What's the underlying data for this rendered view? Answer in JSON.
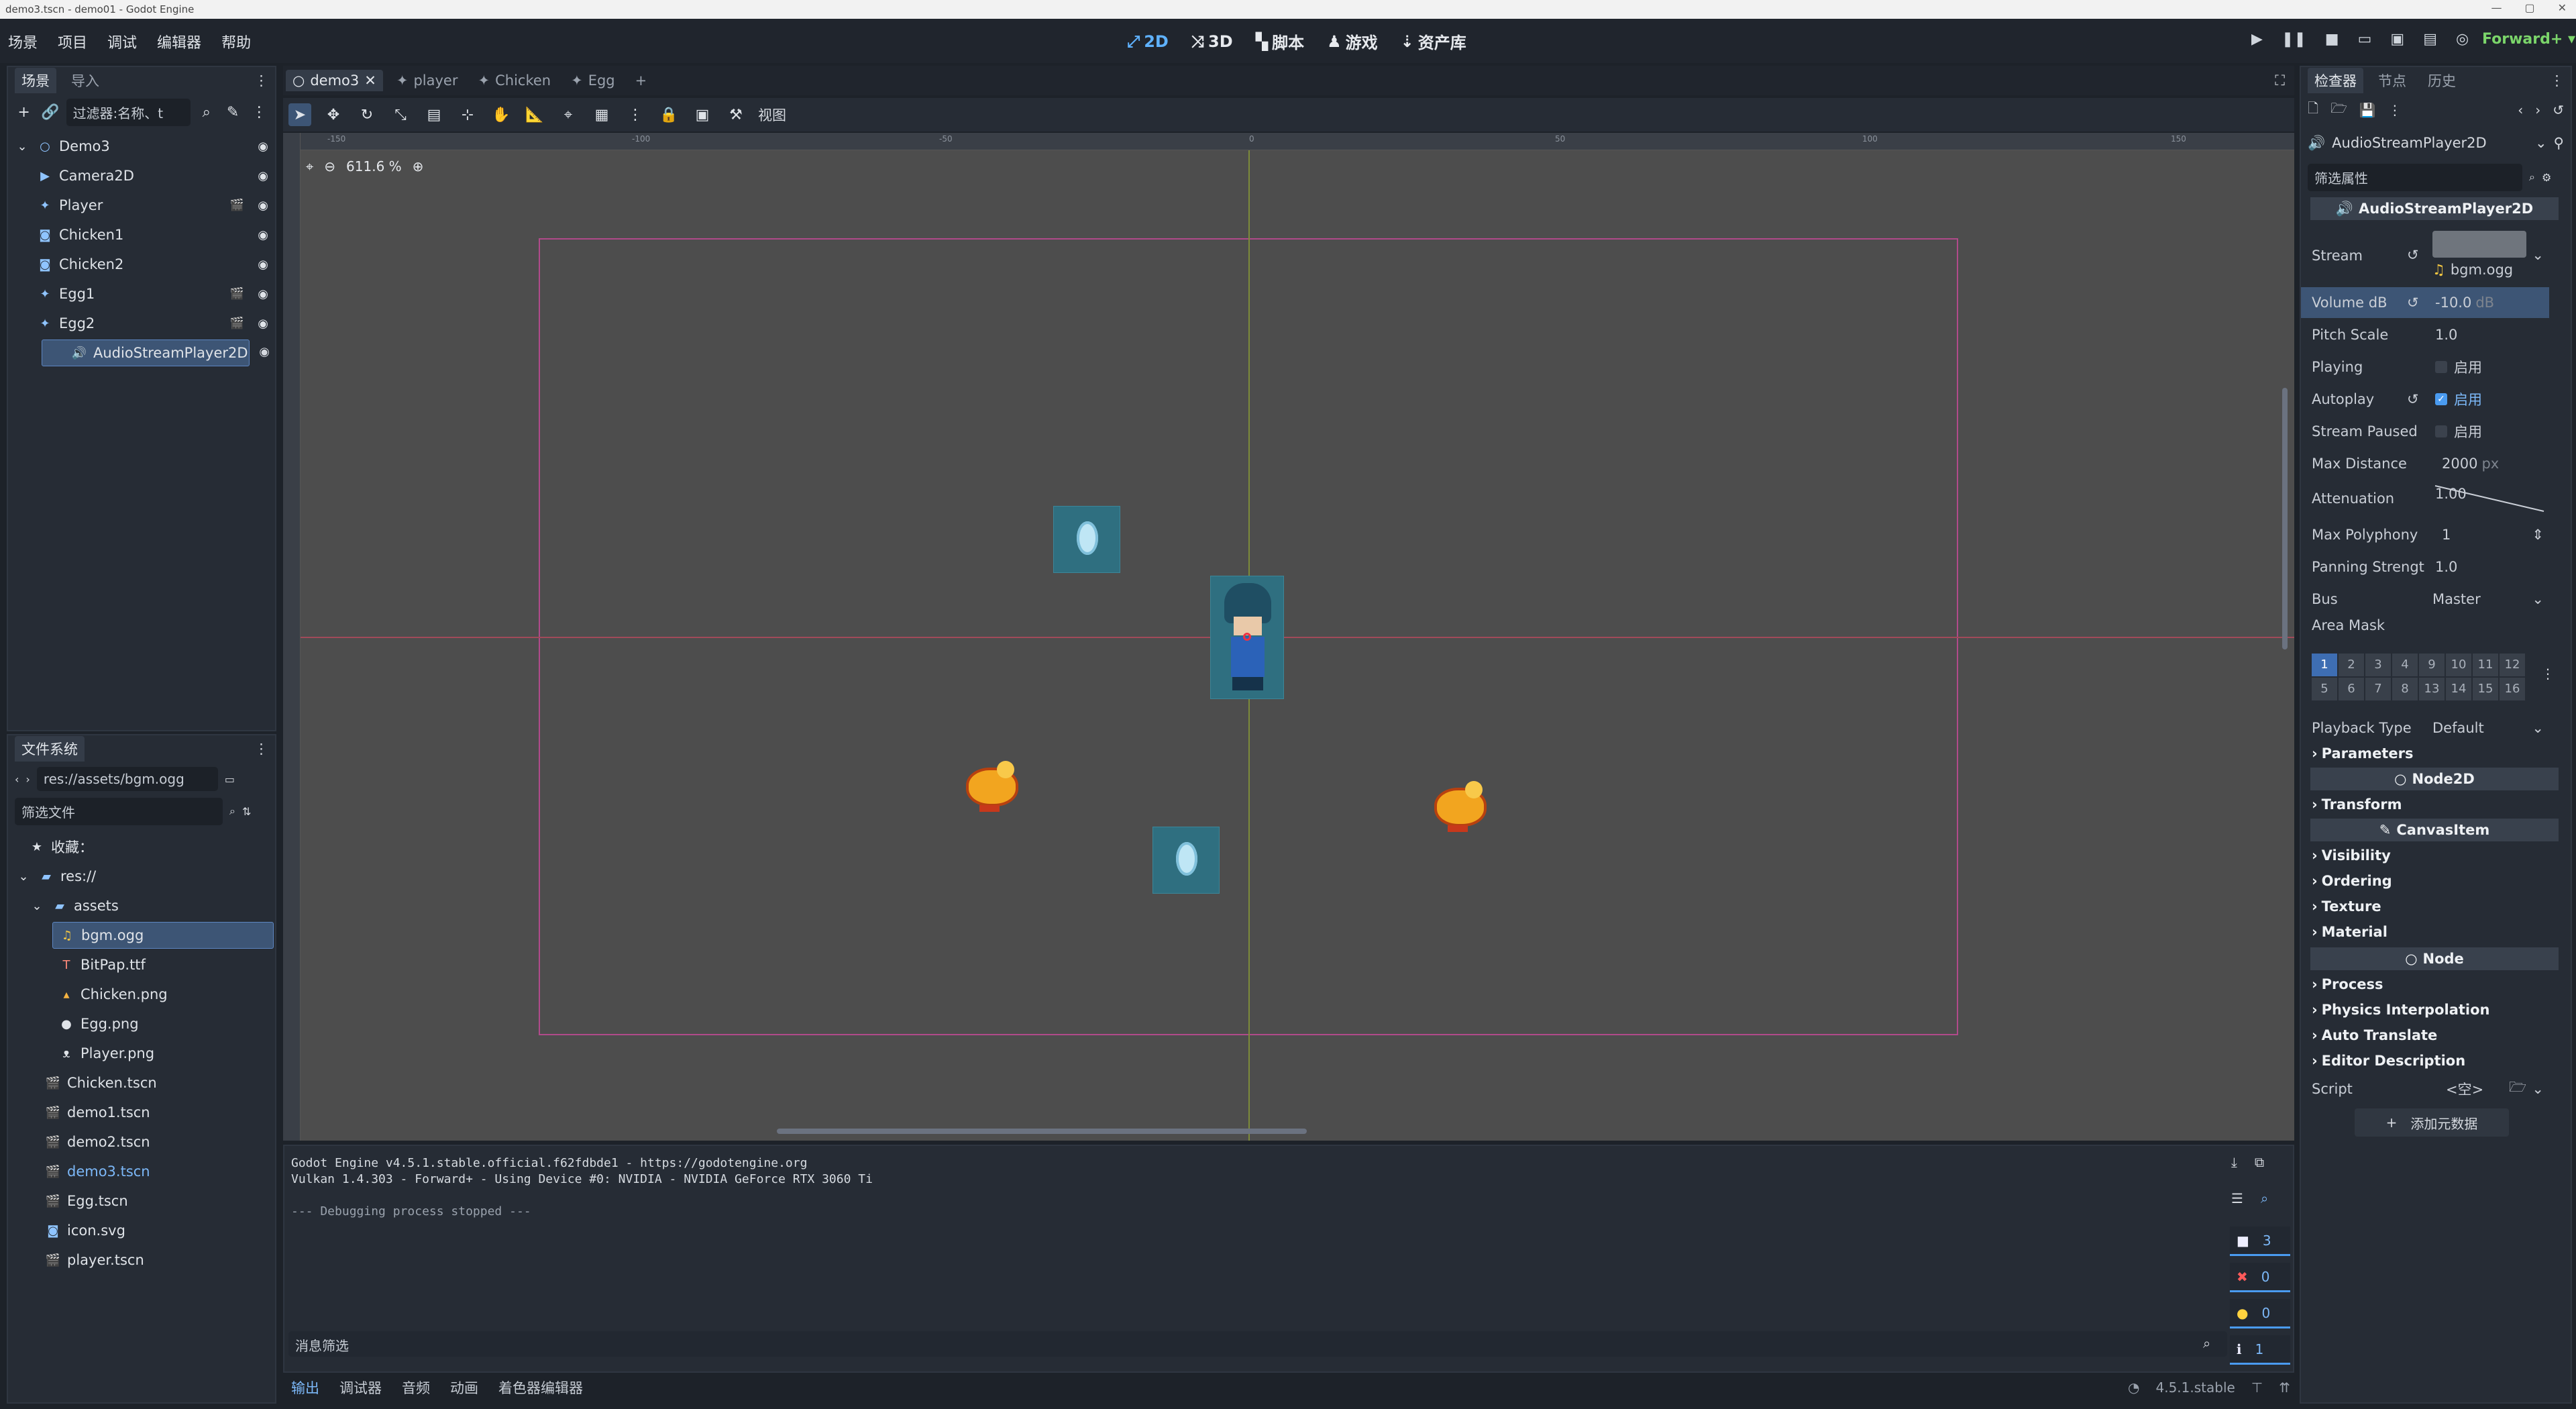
{
  "window": {
    "title": "demo3.tscn - demo01 - Godot Engine"
  },
  "menu": {
    "items": [
      "场景",
      "项目",
      "调试",
      "编辑器",
      "帮助"
    ]
  },
  "main_screens": [
    {
      "label": "2D",
      "icon": "2d-icon",
      "active": true
    },
    {
      "label": "3D",
      "icon": "3d-icon",
      "active": false
    },
    {
      "label": "脚本",
      "icon": "script-icon",
      "active": false
    },
    {
      "label": "游戏",
      "icon": "game-icon",
      "active": false
    },
    {
      "label": "资产库",
      "icon": "assetlib-icon",
      "active": false
    }
  ],
  "renderer": "Forward+",
  "scene_dock": {
    "tabs": [
      "场景",
      "导入"
    ],
    "filter_placeholder": "过滤器:名称、t",
    "nodes": [
      {
        "name": "Demo3",
        "icon": "node2d-icon"
      },
      {
        "name": "Camera2D",
        "icon": "camera-icon"
      },
      {
        "name": "Player",
        "icon": "character-icon"
      },
      {
        "name": "Chicken1",
        "icon": "area-icon"
      },
      {
        "name": "Chicken2",
        "icon": "area-icon"
      },
      {
        "name": "Egg1",
        "icon": "character-icon"
      },
      {
        "name": "Egg2",
        "icon": "character-icon"
      },
      {
        "name": "AudioStreamPlayer2D",
        "icon": "audio-icon"
      }
    ]
  },
  "filesystem": {
    "title": "文件系统",
    "path": "res://assets/bgm.ogg",
    "filter_placeholder": "筛选文件",
    "favorites": "收藏：",
    "items": [
      {
        "name": "res://",
        "icon": "folder-icon"
      },
      {
        "name": "assets",
        "icon": "folder-icon"
      },
      {
        "name": "bgm.ogg",
        "icon": "audio-file-icon"
      },
      {
        "name": "BitPap.ttf",
        "icon": "font-icon"
      },
      {
        "name": "Chicken.png",
        "icon": "image-icon"
      },
      {
        "name": "Egg.png",
        "icon": "image-icon"
      },
      {
        "name": "Player.png",
        "icon": "image-icon"
      },
      {
        "name": "Chicken.tscn",
        "icon": "scene-icon"
      },
      {
        "name": "demo1.tscn",
        "icon": "scene-icon"
      },
      {
        "name": "demo2.tscn",
        "icon": "scene-icon"
      },
      {
        "name": "demo3.tscn",
        "icon": "scene-icon"
      },
      {
        "name": "Egg.tscn",
        "icon": "scene-icon"
      },
      {
        "name": "icon.svg",
        "icon": "svg-icon"
      },
      {
        "name": "player.tscn",
        "icon": "scene-icon"
      }
    ]
  },
  "editor_tabs": [
    "demo3",
    "player",
    "Chicken",
    "Egg"
  ],
  "viewport": {
    "zoom": "611.6 %",
    "view_menu": "视图",
    "ruler_top": [
      "-150",
      "-100",
      "-50",
      "0",
      "50",
      "100",
      "150"
    ]
  },
  "output": {
    "lines": [
      "Godot Engine v4.5.1.stable.official.f62fdbde1 - https://godotengine.org",
      "Vulkan 1.4.303 - Forward+ - Using Device #0: NVIDIA - NVIDIA GeForce RTX 3060 Ti",
      "",
      "--- Debugging process stopped ---"
    ],
    "filter_placeholder": "消息筛选",
    "counts": {
      "messages": "3",
      "errors": "0",
      "warnings": "0",
      "info": "1"
    }
  },
  "bottom_tabs": [
    "输出",
    "调试器",
    "音频",
    "动画",
    "着色器编辑器"
  ],
  "version": "4.5.1.stable",
  "inspector": {
    "tabs": [
      "检查器",
      "节点",
      "历史"
    ],
    "node_name": "AudioStreamPlayer2D",
    "filter_placeholder": "筛选属性",
    "class_header": "AudioStreamPlayer2D",
    "properties": [
      {
        "label": "Stream",
        "value": "bgm.ogg"
      },
      {
        "label": "Volume dB",
        "value": "-10.0",
        "unit": "dB"
      },
      {
        "label": "Pitch Scale",
        "value": "1.0"
      },
      {
        "label": "Playing",
        "value": "启用",
        "checked": false
      },
      {
        "label": "Autoplay",
        "value": "启用",
        "checked": true
      },
      {
        "label": "Stream Paused",
        "value": "启用",
        "checked": false
      },
      {
        "label": "Max Distance",
        "value": "2000",
        "unit": "px"
      },
      {
        "label": "Attenuation",
        "value": "1.00"
      },
      {
        "label": "Max Polyphony",
        "value": "1"
      },
      {
        "label": "Panning Strengt",
        "value": "1.0"
      },
      {
        "label": "Bus",
        "value": "Master"
      },
      {
        "label": "Area Mask",
        "value": ""
      }
    ],
    "area_mask_bits": [
      "1",
      "2",
      "3",
      "4",
      "9",
      "10",
      "11",
      "12",
      "5",
      "6",
      "7",
      "8",
      "13",
      "14",
      "15",
      "16"
    ],
    "playback_type": {
      "label": "Playback Type",
      "value": "Default"
    },
    "sections": {
      "parameters": "Parameters",
      "node2d": "Node2D",
      "transform": "Transform",
      "canvasitem": "CanvasItem",
      "visibility": "Visibility",
      "ordering": "Ordering",
      "texture": "Texture",
      "material": "Material",
      "node": "Node",
      "process": "Process",
      "physics_interp": "Physics Interpolation",
      "auto_translate": "Auto Translate",
      "editor_desc": "Editor Description"
    },
    "script": {
      "label": "Script",
      "value": "<空>"
    },
    "add_metadata": "添加元数据"
  },
  "colors": {
    "accent": "#5fb2ff",
    "selection": "#3d5575",
    "renderer": "#7bd56a"
  }
}
